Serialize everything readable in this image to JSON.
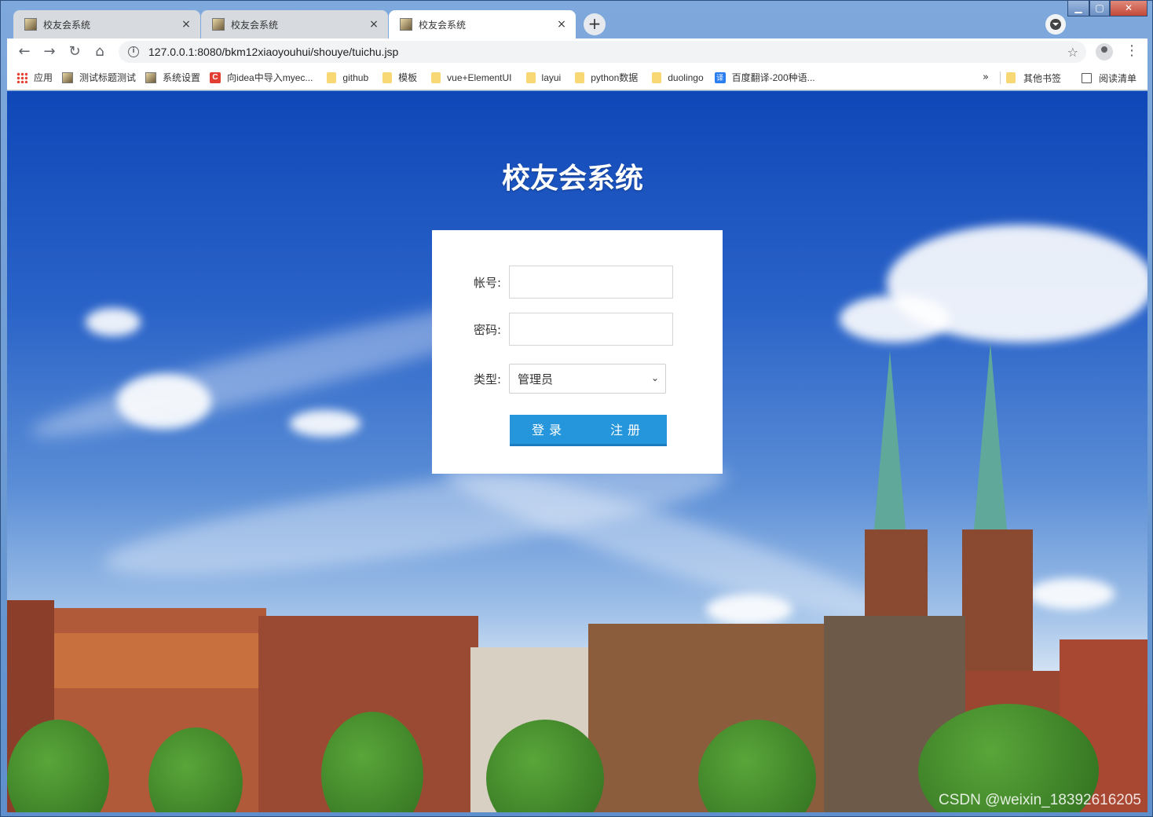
{
  "browser": {
    "tabs": [
      {
        "title": "校友会系统",
        "active": false
      },
      {
        "title": "校友会系统",
        "active": false
      },
      {
        "title": "校友会系统",
        "active": true
      }
    ],
    "new_tab_symbol": "+",
    "close_symbol": "×",
    "url": "127.0.0.1:8080/bkm12xiaoyouhui/shouye/tuichu.jsp",
    "icons": [
      "back-arrow-icon",
      "forward-arrow-icon",
      "reload-icon",
      "home-icon",
      "info-icon",
      "star-icon",
      "profile-icon",
      "menu-icon"
    ]
  },
  "bookmarks": {
    "items": [
      {
        "label": "应用",
        "icon": "apps-icon"
      },
      {
        "label": "测试标题测试",
        "icon": "image-icon"
      },
      {
        "label": "系统设置",
        "icon": "image-icon"
      },
      {
        "label": "向idea中导入myec...",
        "icon": "csdn-icon"
      },
      {
        "label": "github",
        "icon": "folder-icon"
      },
      {
        "label": "模板",
        "icon": "folder-icon"
      },
      {
        "label": "vue+ElementUI",
        "icon": "folder-icon"
      },
      {
        "label": "layui",
        "icon": "folder-icon"
      },
      {
        "label": "python数据",
        "icon": "folder-icon"
      },
      {
        "label": "duolingo",
        "icon": "folder-icon"
      },
      {
        "label": "百度翻译-200种语...",
        "icon": "fanyi-icon"
      }
    ],
    "more": "»",
    "other": "其他书签",
    "reading_list": "阅读清单"
  },
  "page": {
    "title": "校友会系统",
    "login": {
      "account_label": "帐号:",
      "account_value": "",
      "password_label": "密码:",
      "password_value": "",
      "type_label": "类型:",
      "type_selected": "管理员",
      "login_button": "登录",
      "register_button": "注册"
    },
    "watermark": "CSDN @weixin_18392616205"
  },
  "colors": {
    "button": "#2596dc",
    "sky": "#1a56c4"
  }
}
